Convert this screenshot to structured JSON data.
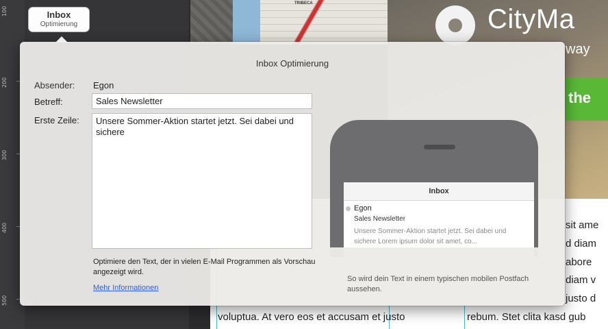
{
  "ruler": {
    "labels": [
      "100",
      "200",
      "300",
      "400",
      "500"
    ]
  },
  "tab": {
    "title": "Inbox",
    "subtitle": "Optimierung"
  },
  "background": {
    "map_label": "TRIBECA",
    "hero_title": "CityMa",
    "hero_subtitle": "way",
    "hero_band": "the",
    "body_left": [
      "voluptua. At vero eos et accusam et justo"
    ],
    "body_right": [
      "sit ame",
      "d diam",
      "abore",
      "diam v",
      "justo d",
      "rebum. Stet clita kasd gub"
    ]
  },
  "popover": {
    "title": "Inbox Optimierung",
    "sender_label": "Absender:",
    "sender_value": "Egon",
    "subject_label": "Betreff:",
    "subject_value": "Sales Newsletter",
    "firstline_label": "Erste Zeile:",
    "firstline_value": "Unsere Sommer-Aktion startet jetzt. Sei dabei und sichere",
    "hint": "Optimiere den Text, der in vielen E-Mail Programmen als Vorschau angezeigt wird.",
    "more_link": "Mehr Informationen",
    "caption": "So wird dein Text in einem typischen mobilen Postfach aussehen."
  },
  "phone": {
    "header": "Inbox",
    "sender": "Egon",
    "subject": "Sales Newsletter",
    "preview": "Unsere Sommer-Aktion startet jetzt. Sei dabei und sichere Lorem ipsum dolor sit amet, co..."
  }
}
